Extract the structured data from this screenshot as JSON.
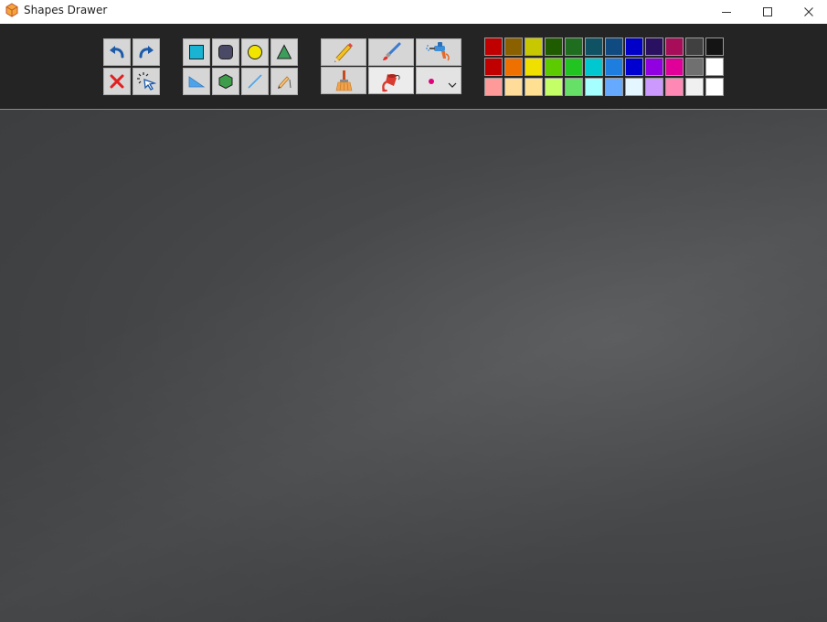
{
  "window": {
    "title": "Shapes Drawer",
    "controls": {
      "minimize": "minimize-icon",
      "maximize": "maximize-icon",
      "close": "close-icon"
    }
  },
  "toolbar": {
    "edit_tools": [
      {
        "name": "undo",
        "icon": "undo-icon"
      },
      {
        "name": "redo",
        "icon": "redo-icon"
      },
      {
        "name": "delete",
        "icon": "delete-x-icon"
      },
      {
        "name": "select",
        "icon": "select-cursor-icon"
      }
    ],
    "shape_tools": [
      {
        "name": "square",
        "icon": "square-icon",
        "color": "#19b3d3"
      },
      {
        "name": "rounded-square",
        "icon": "rounded-square-icon",
        "color": "#4a4a66"
      },
      {
        "name": "circle",
        "icon": "circle-icon",
        "color": "#f2e600"
      },
      {
        "name": "triangle",
        "icon": "triangle-icon",
        "color": "#3c9e5a"
      },
      {
        "name": "right-triangle",
        "icon": "right-triangle-icon",
        "color": "#4da3ea"
      },
      {
        "name": "hexagon",
        "icon": "hexagon-icon",
        "color": "#3d9d4a"
      },
      {
        "name": "line",
        "icon": "line-icon",
        "color": "#4da3ea"
      },
      {
        "name": "freehand",
        "icon": "pencil-line-icon",
        "color": "#e0a060"
      }
    ],
    "brush_tools": [
      {
        "name": "pencil",
        "icon": "pencil-icon",
        "active": false
      },
      {
        "name": "brush",
        "icon": "brush-icon",
        "active": false
      },
      {
        "name": "spray",
        "icon": "spray-gun-icon",
        "active": false
      },
      {
        "name": "clear",
        "icon": "broom-icon",
        "active": false
      },
      {
        "name": "fill",
        "icon": "paint-bucket-icon",
        "active": true
      }
    ],
    "brush_size": {
      "icon": "brush-size-dot-icon",
      "color": "#e0007a"
    }
  },
  "palette": [
    [
      "#c00000",
      "#8b6100",
      "#c8c800",
      "#1f5c00",
      "#1f6e1f",
      "#0e5264",
      "#0f4a80",
      "#0000c8",
      "#2a1060",
      "#a80d5a",
      "#404040",
      "#141414"
    ],
    [
      "#c00000",
      "#ee7100",
      "#f0e000",
      "#5ccc00",
      "#22c422",
      "#00c8d0",
      "#1e7ee0",
      "#0000d0",
      "#9000e0",
      "#e00099",
      "#707070",
      "#ffffff"
    ],
    [
      "#ff9a9a",
      "#ffdc9a",
      "#ffe092",
      "#c4ff68",
      "#66e066",
      "#a6ffff",
      "#66aaff",
      "#e4f6ff",
      "#cc99ff",
      "#ff88b4",
      "#f0f0f0",
      "#ffffff"
    ]
  ]
}
